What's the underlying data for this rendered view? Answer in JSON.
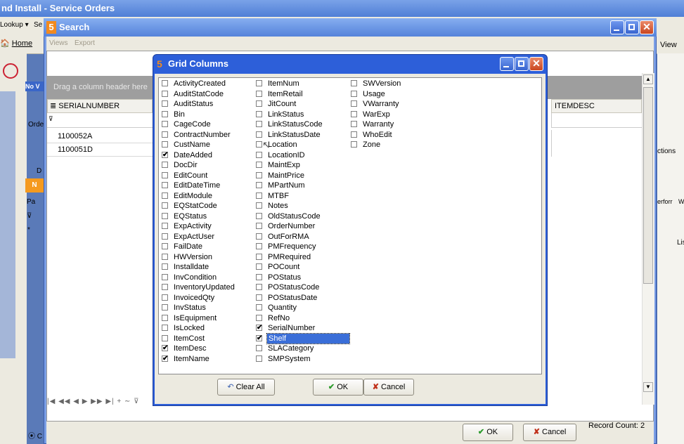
{
  "app": {
    "title": "nd Install - Service Orders",
    "menu": [
      "Lookup ▾",
      "Se"
    ],
    "home_label": "Home",
    "right_label": "View",
    "actions_label": "ctions",
    "perf_label": "erforr",
    "w_label": "W",
    "lis_label": "Lis",
    "left_labels": [
      "No V",
      "Orde",
      "D",
      "N",
      "Pa"
    ]
  },
  "search": {
    "title": "Search",
    "menu": [
      "Views",
      "Export"
    ],
    "drop_hint": "Drag a column header here",
    "columns": [
      "SERIALNUMBER",
      "ITEMDESC"
    ],
    "rows": [
      "1100052A",
      "1100051D"
    ],
    "ok_label": "OK",
    "cancel_label": "Cancel",
    "record_count": "Record Count: 2"
  },
  "dialog": {
    "title": "Grid Columns",
    "clear_all_label": "Clear All",
    "ok_label": "OK",
    "cancel_label": "Cancel",
    "columns": [
      [
        {
          "label": "ActivityCreated",
          "checked": false
        },
        {
          "label": "AuditStatCode",
          "checked": false
        },
        {
          "label": "AuditStatus",
          "checked": false
        },
        {
          "label": "Bin",
          "checked": false
        },
        {
          "label": "CageCode",
          "checked": false
        },
        {
          "label": "ContractNumber",
          "checked": false
        },
        {
          "label": "CustName",
          "checked": false
        },
        {
          "label": "DateAdded",
          "checked": true
        },
        {
          "label": "DocDir",
          "checked": false
        },
        {
          "label": "EditCount",
          "checked": false
        },
        {
          "label": "EditDateTime",
          "checked": false
        },
        {
          "label": "EditModule",
          "checked": false
        },
        {
          "label": "EQStatCode",
          "checked": false
        },
        {
          "label": "EQStatus",
          "checked": false
        },
        {
          "label": "ExpActivity",
          "checked": false
        },
        {
          "label": "ExpActUser",
          "checked": false
        },
        {
          "label": "FailDate",
          "checked": false
        },
        {
          "label": "HWVersion",
          "checked": false
        },
        {
          "label": "Installdate",
          "checked": false
        },
        {
          "label": "InvCondition",
          "checked": false
        },
        {
          "label": "InventoryUpdated",
          "checked": false
        },
        {
          "label": "InvoicedQty",
          "checked": false
        },
        {
          "label": "InvStatus",
          "checked": false
        },
        {
          "label": "IsEquipment",
          "checked": false
        },
        {
          "label": "IsLocked",
          "checked": false
        },
        {
          "label": "ItemCost",
          "checked": false
        },
        {
          "label": "ItemDesc",
          "checked": true
        },
        {
          "label": "ItemName",
          "checked": true
        }
      ],
      [
        {
          "label": "ItemNum",
          "checked": false
        },
        {
          "label": "ItemRetail",
          "checked": false
        },
        {
          "label": "JitCount",
          "checked": false
        },
        {
          "label": "LinkStatus",
          "checked": false
        },
        {
          "label": "LinkStatusCode",
          "checked": false
        },
        {
          "label": "LinkStatusDate",
          "checked": false
        },
        {
          "label": "Location",
          "checked": false
        },
        {
          "label": "LocationID",
          "checked": false
        },
        {
          "label": "MaintExp",
          "checked": false
        },
        {
          "label": "MaintPrice",
          "checked": false
        },
        {
          "label": "MPartNum",
          "checked": false
        },
        {
          "label": "MTBF",
          "checked": false
        },
        {
          "label": "Notes",
          "checked": false
        },
        {
          "label": "OldStatusCode",
          "checked": false
        },
        {
          "label": "OrderNumber",
          "checked": false
        },
        {
          "label": "OutForRMA",
          "checked": false
        },
        {
          "label": "PMFrequency",
          "checked": false
        },
        {
          "label": "PMRequired",
          "checked": false
        },
        {
          "label": "POCount",
          "checked": false
        },
        {
          "label": "POStatus",
          "checked": false
        },
        {
          "label": "POStatusCode",
          "checked": false
        },
        {
          "label": "POStatusDate",
          "checked": false
        },
        {
          "label": "Quantity",
          "checked": false
        },
        {
          "label": "RefNo",
          "checked": false
        },
        {
          "label": "SerialNumber",
          "checked": true
        },
        {
          "label": "Shelf",
          "checked": true,
          "selected": true
        },
        {
          "label": "SLACategory",
          "checked": false
        },
        {
          "label": "SMPSystem",
          "checked": false
        }
      ],
      [
        {
          "label": "SWVersion",
          "checked": false
        },
        {
          "label": "Usage",
          "checked": false
        },
        {
          "label": "VWarranty",
          "checked": false
        },
        {
          "label": "WarExp",
          "checked": false
        },
        {
          "label": "Warranty",
          "checked": false
        },
        {
          "label": "WhoEdit",
          "checked": false
        },
        {
          "label": "Zone",
          "checked": false
        }
      ]
    ]
  }
}
